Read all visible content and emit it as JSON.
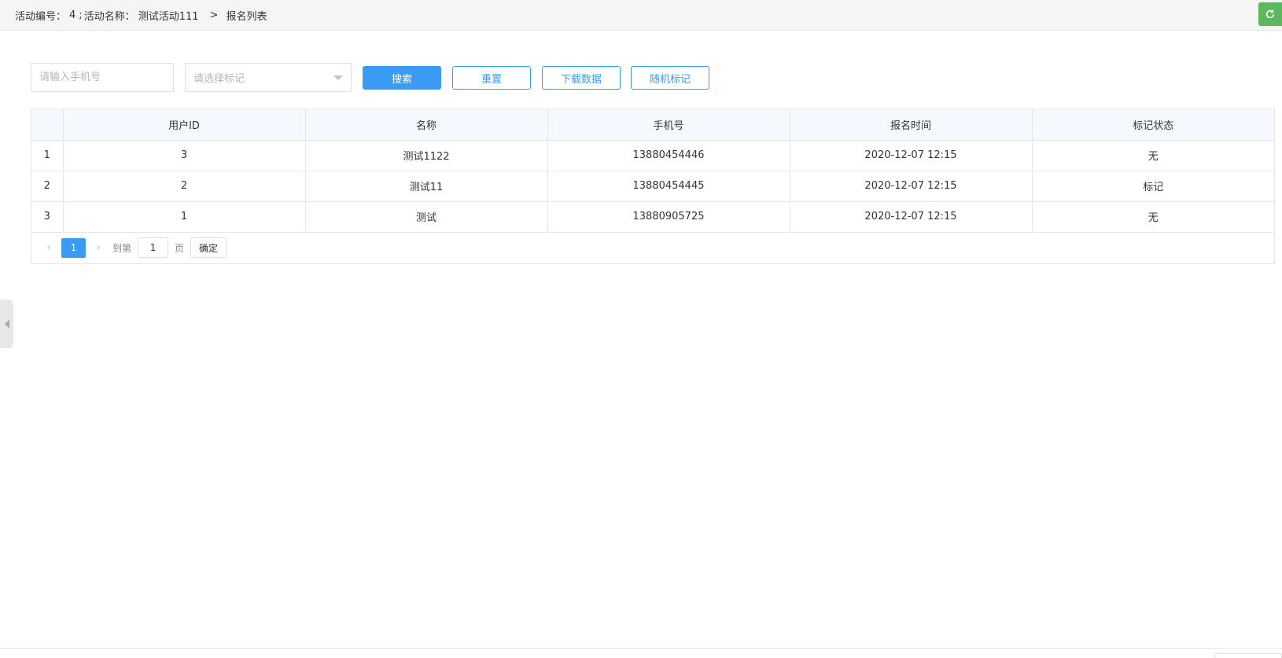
{
  "header": {
    "activity_no_label": "活动编号：",
    "activity_no": "4",
    "separator": ";",
    "activity_name_label": "活动名称：",
    "activity_name": "测试活动111",
    "arrow": ">",
    "page_title": "报名列表"
  },
  "colors": {
    "primary": "#3a9bf4",
    "refresh": "#5cb85c"
  },
  "search": {
    "phone_placeholder": "请输入手机号",
    "mark_placeholder": "请选择标记"
  },
  "buttons": {
    "search": "搜索",
    "reset": "重置",
    "download": "下载数据",
    "random_mark": "随机标记"
  },
  "table": {
    "columns": [
      "",
      "用户ID",
      "名称",
      "手机号",
      "报名时间",
      "标记状态"
    ],
    "rows": [
      {
        "index": "1",
        "user_id": "3",
        "name": "测试1122",
        "phone": "13880454446",
        "time": "2020-12-07 12:15",
        "status": "无"
      },
      {
        "index": "2",
        "user_id": "2",
        "name": "测试11",
        "phone": "13880454445",
        "time": "2020-12-07 12:15",
        "status": "标记"
      },
      {
        "index": "3",
        "user_id": "1",
        "name": "测试",
        "phone": "13880905725",
        "time": "2020-12-07 12:15",
        "status": "无"
      }
    ]
  },
  "pager": {
    "current": "1",
    "goto_label": "到第",
    "goto_value": "1",
    "page_label": "页",
    "confirm": "确定",
    "prev_icon": "chevron-left-icon",
    "next_icon": "chevron-right-icon"
  }
}
